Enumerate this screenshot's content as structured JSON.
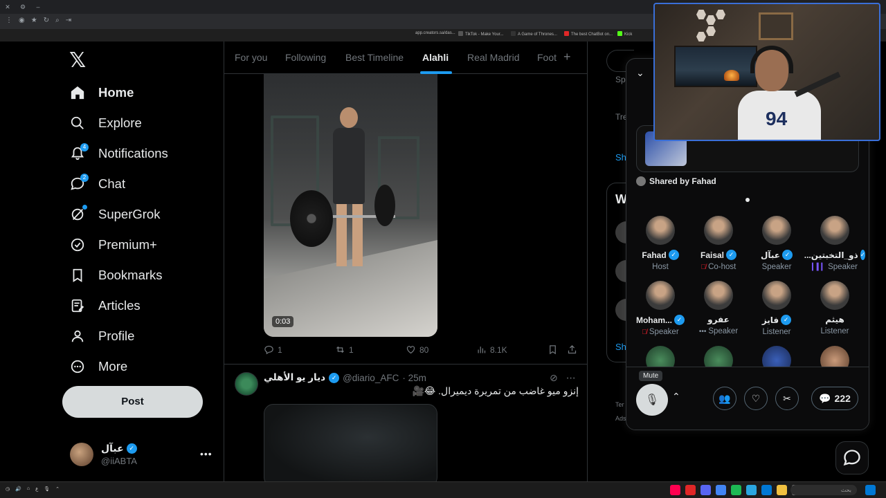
{
  "nav": {
    "items": [
      {
        "label": "Home",
        "icon": "home-icon"
      },
      {
        "label": "Explore",
        "icon": "search-icon"
      },
      {
        "label": "Notifications",
        "icon": "bell-icon",
        "badge": "4"
      },
      {
        "label": "Chat",
        "icon": "chat-icon",
        "badge": "2"
      },
      {
        "label": "SuperGrok",
        "icon": "grok-icon"
      },
      {
        "label": "Premium+",
        "icon": "premium-icon"
      },
      {
        "label": "Bookmarks",
        "icon": "bookmark-icon"
      },
      {
        "label": "Articles",
        "icon": "articles-icon"
      },
      {
        "label": "Profile",
        "icon": "profile-icon"
      },
      {
        "label": "More",
        "icon": "more-icon"
      }
    ],
    "post_label": "Post",
    "user": {
      "name": "عبآل",
      "handle": "@iiABTA"
    }
  },
  "bookmarks_bar": [
    "app.creators.sa/das...",
    "TikTok - Make Your...",
    "A Game of Thrones...",
    "The best ChatBot on...",
    "Kick"
  ],
  "tabs": [
    "For you",
    "Following",
    "Best Timeline",
    "Alahli",
    "Real Madrid",
    "Foot"
  ],
  "active_tab": "Alahli",
  "tweet1": {
    "video_time": "0:03",
    "replies": "1",
    "reposts": "1",
    "likes": "80",
    "views": "8.1K"
  },
  "tweet2": {
    "name": "ديار يو الأهلي",
    "handle": "@diario_AFC",
    "time": "· 25m",
    "text": "إنزو ميو غاضب من تمريرة ديميرال. 😂🎥"
  },
  "right_column": {
    "spo": "Spo",
    "tre": "Tre",
    "sh1": "Sh",
    "w": "W",
    "sh2": "Sh",
    "ter": "Ter",
    "ads": "Ads"
  },
  "space": {
    "shared_by": "Shared by Fahad",
    "participants": [
      {
        "name": "Fahad",
        "verified": true,
        "role": "Host",
        "mic": ""
      },
      {
        "name": "Faisal",
        "verified": true,
        "role": "Co-host",
        "mic": "off"
      },
      {
        "name": "عبآل",
        "verified": true,
        "role": "Speaker",
        "mic": ""
      },
      {
        "name": "...ذو_التخبتين",
        "verified": true,
        "role": "Speaker",
        "mic": "on"
      },
      {
        "name": "Moham...",
        "verified": true,
        "role": "Speaker",
        "mic": "off"
      },
      {
        "name": "عفرو",
        "verified": false,
        "role": "Speaker",
        "mic": "dots"
      },
      {
        "name": "فايز",
        "verified": true,
        "role": "Listener",
        "mic": ""
      },
      {
        "name": "هيثم",
        "verified": false,
        "role": "Listener",
        "mic": ""
      }
    ],
    "mute_tooltip": "Mute",
    "comments_count": "222"
  },
  "taskbar": {
    "search_label": "بحث"
  },
  "colors": {
    "accent": "#1d9bf0",
    "background": "#000000",
    "muted_text": "#71767b",
    "mic_off": "#f4212e"
  }
}
